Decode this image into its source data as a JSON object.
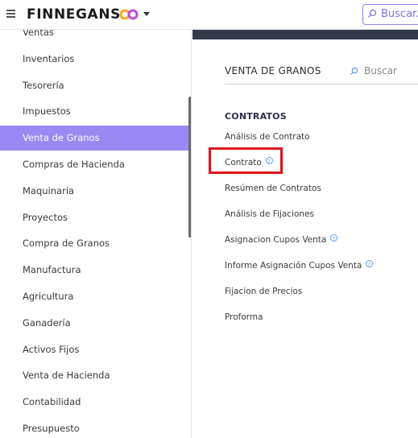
{
  "header": {
    "brand": "FINNEGANS",
    "search_placeholder": "Buscar..."
  },
  "sidebar": {
    "items": [
      {
        "label": "Ventas",
        "active": false
      },
      {
        "label": "Inventarios",
        "active": false
      },
      {
        "label": "Tesorería",
        "active": false
      },
      {
        "label": "Impuestos",
        "active": false
      },
      {
        "label": "Venta de Granos",
        "active": true
      },
      {
        "label": "Compras de Hacienda",
        "active": false
      },
      {
        "label": "Maquinaria",
        "active": false
      },
      {
        "label": "Proyectos",
        "active": false
      },
      {
        "label": "Compra de Granos",
        "active": false
      },
      {
        "label": "Manufactura",
        "active": false
      },
      {
        "label": "Agricultura",
        "active": false
      },
      {
        "label": "Ganadería",
        "active": false
      },
      {
        "label": "Activos Fijos",
        "active": false
      },
      {
        "label": "Venta de Hacienda",
        "active": false
      },
      {
        "label": "Contabilidad",
        "active": false
      },
      {
        "label": "Presupuesto",
        "active": false
      }
    ]
  },
  "main": {
    "section_title": "VENTA DE GRANOS",
    "search_placeholder": "Buscar",
    "group_title": "CONTRATOS",
    "links": [
      {
        "label": "Análisis de Contrato",
        "help": false
      },
      {
        "label": "Contrato",
        "help": true
      },
      {
        "label": "Resúmen de Contratos",
        "help": false
      },
      {
        "label": "Análisis de Fijaciones",
        "help": false
      },
      {
        "label": "Asignacion Cupos Venta",
        "help": true
      },
      {
        "label": "Informe Asignación Cupos Venta",
        "help": true
      },
      {
        "label": "Fijacion de Precios",
        "help": false
      },
      {
        "label": "Proforma",
        "help": false
      }
    ]
  },
  "colors": {
    "accent": "#9a88f3",
    "highlight": "#e0121c",
    "header_band": "#343a4a"
  }
}
